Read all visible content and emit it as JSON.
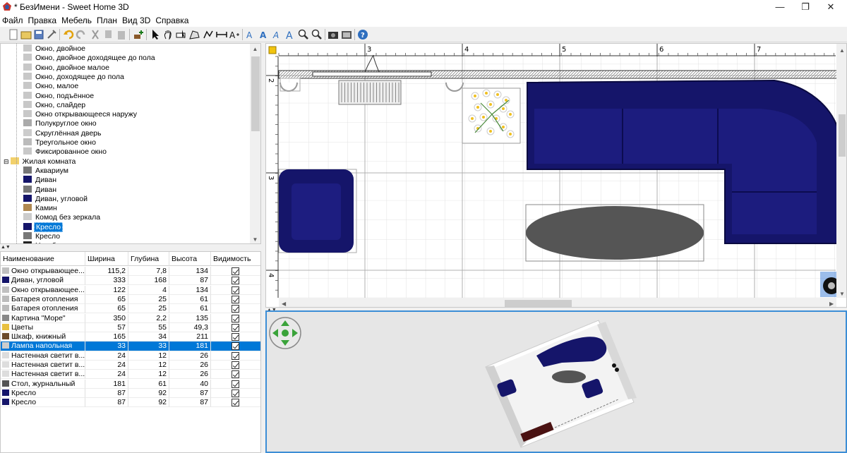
{
  "window": {
    "title": "* БезИмени - Sweet Home 3D",
    "minimize_glyph": "—",
    "maximize_glyph": "❐",
    "close_glyph": "✕"
  },
  "menu": [
    "Файл",
    "Правка",
    "Мебель",
    "План",
    "Вид 3D",
    "Справка"
  ],
  "toolbar_icons": [
    "new-home-icon",
    "open-icon",
    "save-icon",
    "preferences-icon",
    "undo-icon",
    "redo-icon",
    "cut-icon",
    "copy-icon",
    "paste-icon",
    "add-furniture-icon",
    "select-mode-icon",
    "pan-mode-icon",
    "create-walls-icon",
    "create-rooms-icon",
    "create-polylines-icon",
    "create-dimensions-icon",
    "add-text-icon",
    "text-style-icon",
    "bold-icon",
    "italic-icon",
    "increase-text-icon",
    "zoom-in-icon",
    "zoom-out-icon",
    "create-photo-icon",
    "create-video-icon",
    "help-icon"
  ],
  "catalog": {
    "items": [
      {
        "label": "Окно, двойное",
        "level": 2,
        "icon": "window-icon"
      },
      {
        "label": "Окно, двойное доходящее до пола",
        "level": 2,
        "icon": "window-icon"
      },
      {
        "label": "Окно, двойное малое",
        "level": 2,
        "icon": "window-icon"
      },
      {
        "label": "Окно, доходящее до пола",
        "level": 2,
        "icon": "window-icon"
      },
      {
        "label": "Окно, малое",
        "level": 2,
        "icon": "window-icon"
      },
      {
        "label": "Окно, подъённое",
        "level": 2,
        "icon": "window-icon"
      },
      {
        "label": "Окно, слайдер",
        "level": 2,
        "icon": "window-icon"
      },
      {
        "label": "Окно открывающееся наружу",
        "level": 2,
        "icon": "window-icon"
      },
      {
        "label": "Полукруглое окно",
        "level": 2,
        "icon": "half-round-window-icon"
      },
      {
        "label": "Скруглённая дверь",
        "level": 2,
        "icon": "door-icon"
      },
      {
        "label": "Треугольное окно",
        "level": 2,
        "icon": "triangle-window-icon"
      },
      {
        "label": "Фиксированное окно",
        "level": 2,
        "icon": "window-icon"
      },
      {
        "label": "Жилая комната",
        "level": 1,
        "icon": "folder-icon"
      },
      {
        "label": "Аквариум",
        "level": 2,
        "icon": "aquarium-icon"
      },
      {
        "label": "Диван",
        "level": 2,
        "icon": "sofa-icon"
      },
      {
        "label": "Диван",
        "level": 2,
        "icon": "sofa-gray-icon"
      },
      {
        "label": "Диван, угловой",
        "level": 2,
        "icon": "corner-sofa-icon"
      },
      {
        "label": "Камин",
        "level": 2,
        "icon": "fireplace-icon"
      },
      {
        "label": "Комод без зеркала",
        "level": 2,
        "icon": "dresser-icon"
      },
      {
        "label": "Кресло",
        "level": 2,
        "icon": "armchair-icon",
        "selected": true
      },
      {
        "label": "Кресло",
        "level": 2,
        "icon": "armchair-gray-icon"
      },
      {
        "label": "Ноутбук",
        "level": 2,
        "icon": "laptop-icon"
      }
    ]
  },
  "furniture_table": {
    "columns": [
      "Наименование",
      "Ширина",
      "Глубина",
      "Высота",
      "Видимость"
    ],
    "rows": [
      {
        "name": "Окно открывающее...",
        "width": "115,2",
        "depth": "7,8",
        "height": "134",
        "visible": true,
        "icon": "window-icon"
      },
      {
        "name": "Диван, угловой",
        "width": "333",
        "depth": "168",
        "height": "87",
        "visible": true,
        "icon": "corner-sofa-icon"
      },
      {
        "name": "Окно открывающее...",
        "width": "122",
        "depth": "4",
        "height": "134",
        "visible": true,
        "icon": "window-icon"
      },
      {
        "name": "Батарея отопления",
        "width": "65",
        "depth": "25",
        "height": "61",
        "visible": true,
        "icon": "radiator-icon"
      },
      {
        "name": "Батарея отопления",
        "width": "65",
        "depth": "25",
        "height": "61",
        "visible": true,
        "icon": "radiator-icon"
      },
      {
        "name": "Картина \"Море\"",
        "width": "350",
        "depth": "2,2",
        "height": "135",
        "visible": true,
        "icon": "picture-icon"
      },
      {
        "name": "Цветы",
        "width": "57",
        "depth": "55",
        "height": "49,3",
        "visible": true,
        "icon": "flowers-icon"
      },
      {
        "name": "Шкаф, книжный",
        "width": "165",
        "depth": "34",
        "height": "211",
        "visible": true,
        "icon": "bookcase-icon"
      },
      {
        "name": "Лампа напольная",
        "width": "33",
        "depth": "33",
        "height": "181",
        "visible": true,
        "icon": "floor-lamp-icon",
        "selected": true
      },
      {
        "name": "Настенная светит в...",
        "width": "24",
        "depth": "12",
        "height": "26",
        "visible": true,
        "icon": "wall-lamp-icon"
      },
      {
        "name": "Настенная светит в...",
        "width": "24",
        "depth": "12",
        "height": "26",
        "visible": true,
        "icon": "wall-lamp-icon"
      },
      {
        "name": "Настенная светит в...",
        "width": "24",
        "depth": "12",
        "height": "26",
        "visible": true,
        "icon": "wall-lamp-icon"
      },
      {
        "name": "Стол, журнальный",
        "width": "181",
        "depth": "61",
        "height": "40",
        "visible": true,
        "icon": "coffee-table-icon"
      },
      {
        "name": "Кресло",
        "width": "87",
        "depth": "92",
        "height": "87",
        "visible": true,
        "icon": "armchair-icon"
      },
      {
        "name": "Кресло",
        "width": "87",
        "depth": "92",
        "height": "87",
        "visible": true,
        "icon": "armchair-icon"
      }
    ]
  },
  "plan": {
    "ruler_x_labels": [
      "3",
      "4",
      "5",
      "6",
      "7"
    ],
    "ruler_y_labels": [
      "2",
      "3",
      "4"
    ],
    "colors": {
      "sofa": "#1a1a6e",
      "table": "#555555",
      "grid": "#d4d4d4"
    }
  },
  "view3d": {
    "navigator_icon": "navigation-arrows-icon"
  }
}
